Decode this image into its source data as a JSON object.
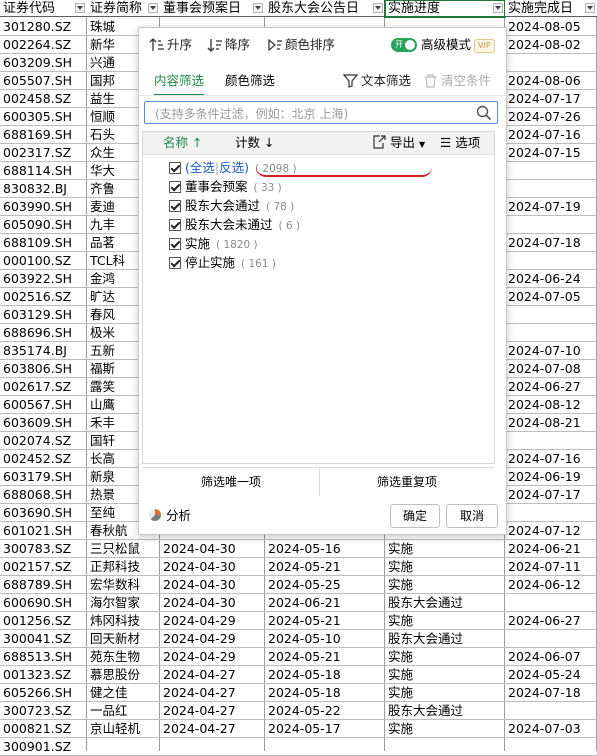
{
  "columns": [
    {
      "label": "证券代码"
    },
    {
      "label": "证券简称"
    },
    {
      "label": "董事会预案日"
    },
    {
      "label": "股东大会公告日"
    },
    {
      "label": "实施进度"
    },
    {
      "label": "实施完成日"
    }
  ],
  "rows": [
    [
      "301280.SZ",
      "珠城",
      "",
      "",
      "",
      "2024-08-05"
    ],
    [
      "002264.SZ",
      "新华",
      "",
      "",
      "",
      "2024-08-02"
    ],
    [
      "603209.SH",
      "兴通",
      "",
      "",
      "",
      ""
    ],
    [
      "605507.SH",
      "国邦",
      "",
      "",
      "",
      "2024-08-06"
    ],
    [
      "002458.SZ",
      "益生",
      "",
      "",
      "",
      "2024-07-17"
    ],
    [
      "600305.SH",
      "恒顺",
      "",
      "",
      "",
      "2024-07-26"
    ],
    [
      "688169.SH",
      "石头",
      "",
      "",
      "",
      "2024-07-16"
    ],
    [
      "002317.SZ",
      "众生",
      "",
      "",
      "",
      "2024-07-15"
    ],
    [
      "688114.SH",
      "华大",
      "",
      "",
      "",
      ""
    ],
    [
      "830832.BJ",
      "齐鲁",
      "",
      "",
      "",
      ""
    ],
    [
      "603990.SH",
      "麦迪",
      "",
      "",
      "",
      "2024-07-19"
    ],
    [
      "605090.SH",
      "九丰",
      "",
      "",
      "",
      ""
    ],
    [
      "688109.SH",
      "品茗",
      "",
      "",
      "",
      "2024-07-18"
    ],
    [
      "000100.SZ",
      "TCL科",
      "",
      "",
      "",
      ""
    ],
    [
      "603922.SH",
      "金鸿",
      "",
      "",
      "",
      "2024-06-24"
    ],
    [
      "002516.SZ",
      "旷达",
      "",
      "",
      "",
      "2024-07-05"
    ],
    [
      "603129.SH",
      "春风",
      "",
      "",
      "",
      ""
    ],
    [
      "688696.SH",
      "极米",
      "",
      "",
      "",
      ""
    ],
    [
      "835174.BJ",
      "五新",
      "",
      "",
      "",
      "2024-07-10"
    ],
    [
      "603806.SH",
      "福斯",
      "",
      "",
      "",
      "2024-07-08"
    ],
    [
      "002617.SZ",
      "露笑",
      "",
      "",
      "",
      "2024-06-27"
    ],
    [
      "600567.SH",
      "山鹰",
      "",
      "",
      "",
      "2024-08-12"
    ],
    [
      "603609.SH",
      "禾丰",
      "",
      "",
      "",
      "2024-08-21"
    ],
    [
      "002074.SZ",
      "国轩",
      "",
      "",
      "",
      ""
    ],
    [
      "002452.SZ",
      "长高",
      "",
      "",
      "",
      "2024-07-16"
    ],
    [
      "603179.SH",
      "新泉",
      "",
      "",
      "",
      "2024-06-19"
    ],
    [
      "688068.SH",
      "热景",
      "",
      "",
      "",
      "2024-07-17"
    ],
    [
      "603690.SH",
      "至纯",
      "",
      "",
      "",
      ""
    ],
    [
      "601021.SH",
      "春秋航",
      "",
      "",
      "",
      "2024-07-12"
    ],
    [
      "300783.SZ",
      "三只松鼠",
      "2024-04-30",
      "2024-05-16",
      "实施",
      "2024-06-21"
    ],
    [
      "002157.SZ",
      "正邦科技",
      "2024-04-30",
      "2024-05-21",
      "实施",
      "2024-07-11"
    ],
    [
      "688789.SH",
      "宏华数科",
      "2024-04-30",
      "2024-05-25",
      "实施",
      "2024-06-12"
    ],
    [
      "600690.SH",
      "海尔智家",
      "2024-04-30",
      "2024-06-21",
      "股东大会通过",
      ""
    ],
    [
      "001256.SZ",
      "炜冈科技",
      "2024-04-29",
      "2024-05-21",
      "实施",
      "2024-06-27"
    ],
    [
      "300041.SZ",
      "回天新材",
      "2024-04-29",
      "2024-05-10",
      "股东大会通过",
      ""
    ],
    [
      "688513.SH",
      "苑东生物",
      "2024-04-29",
      "2024-05-21",
      "实施",
      "2024-06-07"
    ],
    [
      "001323.SZ",
      "慕思股份",
      "2024-04-27",
      "2024-05-18",
      "实施",
      "2024-05-24"
    ],
    [
      "605266.SH",
      "健之佳",
      "2024-04-27",
      "2024-05-18",
      "实施",
      "2024-07-18"
    ],
    [
      "300723.SZ",
      "一品红",
      "2024-04-27",
      "2024-05-22",
      "股东大会通过",
      ""
    ],
    [
      "000821.SZ",
      "京山轻机",
      "2024-04-27",
      "2024-05-17",
      "实施",
      "2024-07-03"
    ],
    [
      "300901.SZ",
      "",
      "",
      "",
      "",
      ""
    ]
  ],
  "filter_popup": {
    "sort_asc": "升序",
    "sort_desc": "降序",
    "color_sort": "颜色排序",
    "toggle_text": "开",
    "advanced_mode": "高级模式",
    "vip": "VIP",
    "tab_content": "内容筛选",
    "tab_color": "颜色筛选",
    "text_filter": "文本筛选",
    "clear_conditions": "清空条件",
    "search_placeholder": "(支持多条件过滤，例如：北京 上海)",
    "col_name": "名称",
    "col_count": "计数",
    "export": "导出",
    "options": "选项",
    "select_all": "(全选",
    "invert": "反选)",
    "items": [
      {
        "label": "(全选|反选)",
        "count": "( 2098 )"
      },
      {
        "label": "董事会预案",
        "count": "( 33 )"
      },
      {
        "label": "股东大会通过",
        "count": "( 78 )"
      },
      {
        "label": "股东大会未通过",
        "count": "( 6 )"
      },
      {
        "label": "实施",
        "count": "( 1820 )"
      },
      {
        "label": "停止实施",
        "count": "( 161 )"
      }
    ],
    "filter_unique": "筛选唯一项",
    "filter_duplicate": "筛选重复项",
    "analysis": "分析",
    "ok": "确定",
    "cancel": "取消"
  }
}
